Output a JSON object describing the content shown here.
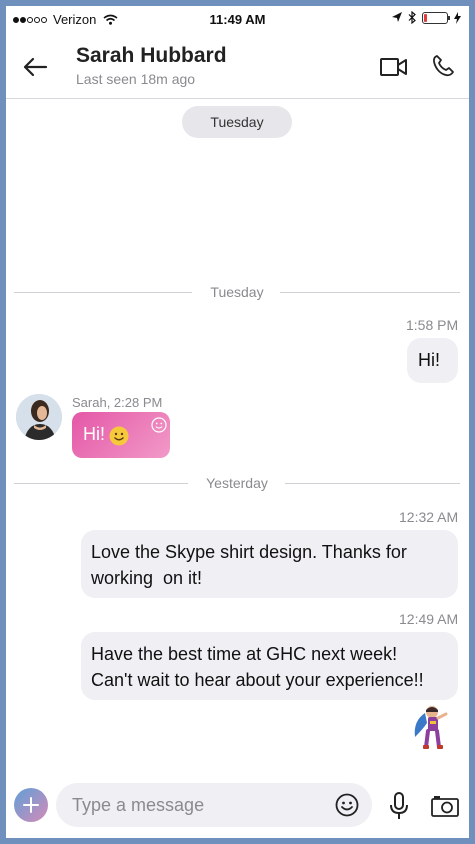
{
  "status_bar": {
    "carrier": "Verizon",
    "time": "11:49 AM",
    "battery_level": 0.15
  },
  "header": {
    "contact_name": "Sarah Hubbard",
    "last_seen": "Last seen 18m ago"
  },
  "chat": {
    "top_pill": "Tuesday",
    "dividers": [
      "Tuesday",
      "Yesterday"
    ],
    "messages": [
      {
        "time": "1:58 PM",
        "text": "Hi!"
      },
      {
        "sender_label": "Sarah, 2:28 PM",
        "text": "Hi!"
      },
      {
        "time": "12:32 AM",
        "text_line1": "Love the Skype shirt design. Thanks for",
        "text_line2": "working  on it!"
      },
      {
        "time": "12:49 AM",
        "text_line1": "Have the best time at GHC next week!",
        "text_line2": "Can't wait to hear about your experience!!"
      }
    ]
  },
  "composer": {
    "placeholder": "Type a message"
  },
  "colors": {
    "background": "#6f90bd",
    "pink_bubble": "#e457a7",
    "bubble": "#efeff4"
  }
}
